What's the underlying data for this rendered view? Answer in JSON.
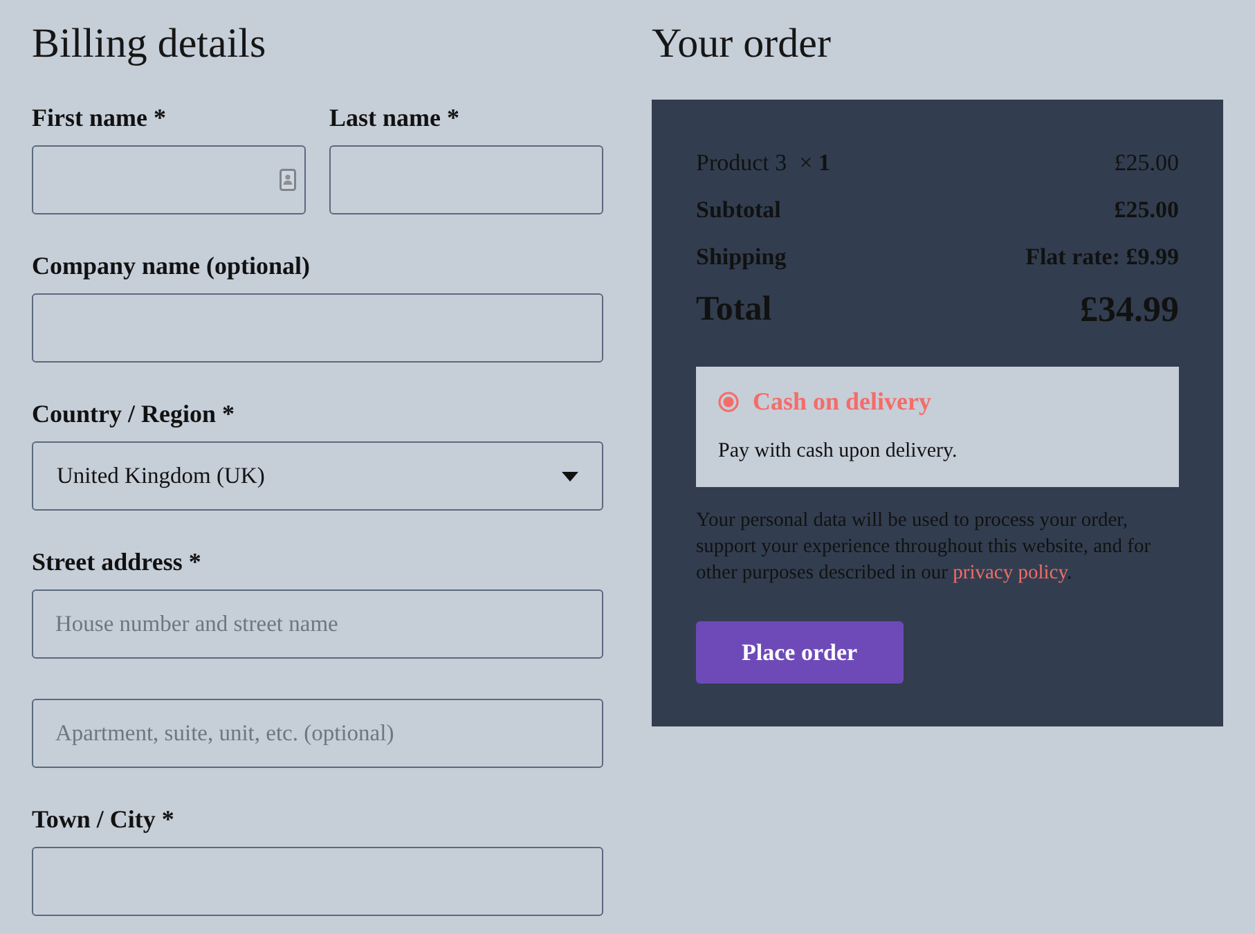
{
  "billing": {
    "title": "Billing details",
    "rows": [
      {
        "fields": [
          {
            "kind": "input",
            "label": "First name *",
            "autofill": true
          },
          {
            "kind": "input",
            "label": "Last name *",
            "autofill": false
          }
        ]
      },
      {
        "fields": [
          {
            "kind": "input",
            "label": "Company name (optional)",
            "autofill": false
          }
        ]
      },
      {
        "fields": [
          {
            "kind": "select",
            "label": "Country / Region *",
            "value": "United Kingdom (UK)"
          }
        ]
      },
      {
        "fields": [
          {
            "kind": "input",
            "label": "Street address *",
            "placeholder": "House number and street name",
            "autofill": false
          }
        ]
      },
      {
        "fields": [
          {
            "kind": "input",
            "placeholder": "Apartment, suite, unit, etc. (optional)",
            "autofill": false
          }
        ]
      },
      {
        "fields": [
          {
            "kind": "input",
            "label": "Town / City *",
            "autofill": false
          }
        ]
      }
    ]
  },
  "order": {
    "title": "Your order",
    "items": [
      {
        "name": "Product 3",
        "quantity": "× **1**",
        "price": "£25.00"
      }
    ],
    "totals": [
      {
        "kind": "subtotal",
        "label": "Subtotal",
        "value": "£25.00"
      },
      {
        "kind": "shipping",
        "label": "Shipping",
        "value": "Flat rate: £9.99"
      },
      {
        "kind": "total",
        "label": "Total",
        "value": "£34.99"
      }
    ],
    "payment_methods": [
      {
        "label": "Cash on delivery",
        "selected": true,
        "description": "Pay with cash upon delivery."
      }
    ],
    "privacy_notice": {
      "text": "Your personal data will be used to process your order, support your experience throughout this website, and for other purposes described in our ",
      "link": "privacy policy",
      "after": "."
    },
    "button": "Place order"
  }
}
